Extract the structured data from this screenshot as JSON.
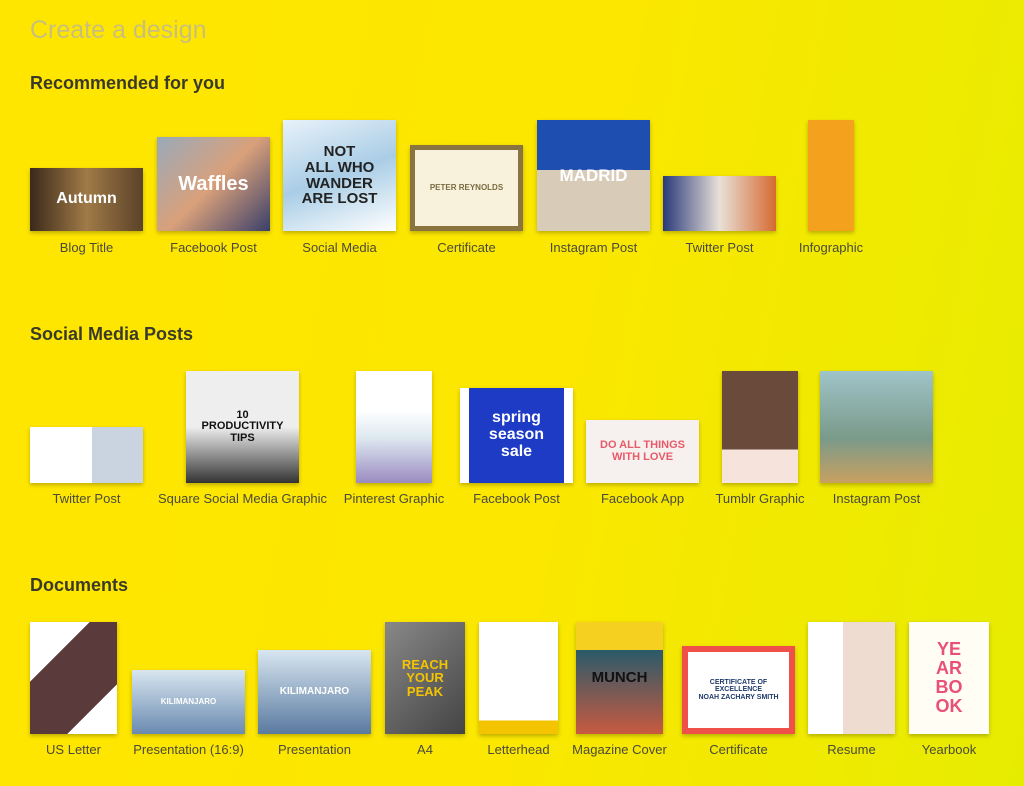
{
  "page_title": "Create a design",
  "sections": [
    {
      "heading": "Recommended for you",
      "items": [
        {
          "label": "Blog Title",
          "thumb_text": "Autumn"
        },
        {
          "label": "Facebook Post",
          "thumb_text": "Waffles"
        },
        {
          "label": "Social Media",
          "thumb_text": "NOT\nALL WHO\nWANDER\nARE LOST"
        },
        {
          "label": "Certificate",
          "thumb_text": "PETER REYNOLDS"
        },
        {
          "label": "Instagram Post",
          "thumb_text": "MADRID"
        },
        {
          "label": "Twitter Post",
          "thumb_text": ""
        },
        {
          "label": "Infographic",
          "thumb_text": ""
        }
      ]
    },
    {
      "heading": "Social Media Posts",
      "items": [
        {
          "label": "Twitter Post",
          "thumb_text": ""
        },
        {
          "label": "Square Social Media Graphic",
          "thumb_text": "10\nPRODUCTIVITY\nTIPS"
        },
        {
          "label": "Pinterest Graphic",
          "thumb_text": ""
        },
        {
          "label": "Facebook Post",
          "thumb_text": "spring\nseason\nsale"
        },
        {
          "label": "Facebook App",
          "thumb_text": "DO ALL THINGS\nWITH LOVE"
        },
        {
          "label": "Tumblr Graphic",
          "thumb_text": ""
        },
        {
          "label": "Instagram Post",
          "thumb_text": ""
        }
      ]
    },
    {
      "heading": "Documents",
      "items": [
        {
          "label": "US Letter",
          "thumb_text": ""
        },
        {
          "label": "Presentation (16:9)",
          "thumb_text": "KILIMANJARO"
        },
        {
          "label": "Presentation",
          "thumb_text": "KILIMANJARO"
        },
        {
          "label": "A4",
          "thumb_text": "REACH\nYOUR\nPEAK"
        },
        {
          "label": "Letterhead",
          "thumb_text": ""
        },
        {
          "label": "Magazine Cover",
          "thumb_text": "MUNCH"
        },
        {
          "label": "Certificate",
          "thumb_text": "CERTIFICATE OF\nEXCELLENCE\nNOAH ZACHARY SMITH"
        },
        {
          "label": "Resume",
          "thumb_text": ""
        },
        {
          "label": "Yearbook",
          "thumb_text": "YE\nAR\nBO\nOK"
        }
      ]
    }
  ]
}
